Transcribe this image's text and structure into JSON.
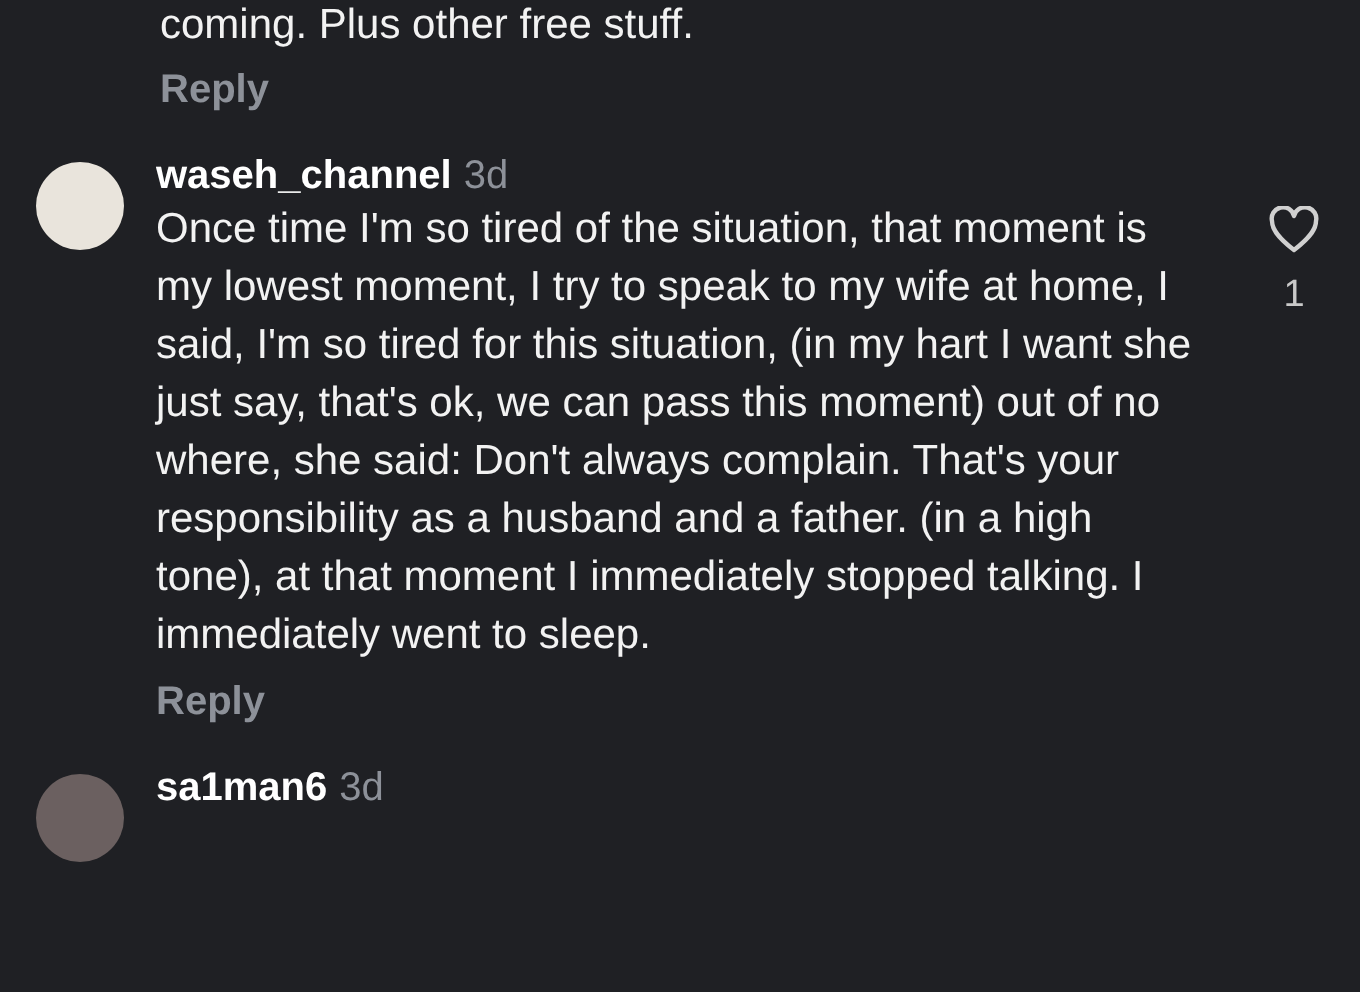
{
  "previous_comment": {
    "text_tail": "coming. Plus other free stuff.",
    "reply": "Reply"
  },
  "comments": [
    {
      "username": "waseh_channel",
      "time": "3d",
      "text": "Once time I'm so tired of the situation, that moment is my lowest moment, I try to speak to my wife at home, I said,  I'm so tired for this situation, (in my hart I want she just say, that's ok, we can pass this moment) out of no where, she said: Don't always complain. That's your responsibility as a husband and a father. (in a high tone), at that moment I immediately stopped talking. I immediately went to sleep.",
      "likes": "1",
      "reply": "Reply"
    },
    {
      "username": "sa1man6",
      "time": "3d"
    }
  ]
}
